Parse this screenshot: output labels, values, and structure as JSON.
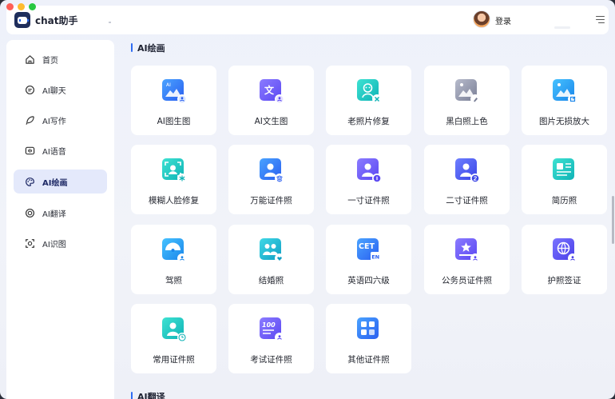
{
  "app": {
    "title": "chat助手"
  },
  "header": {
    "login_label": "登录"
  },
  "sidebar": {
    "items": [
      {
        "id": "home",
        "label": "首页",
        "icon": "home-icon",
        "active": false
      },
      {
        "id": "chat",
        "label": "AI聊天",
        "icon": "chat-bubble-icon",
        "active": false
      },
      {
        "id": "write",
        "label": "AI写作",
        "icon": "feather-icon",
        "active": false
      },
      {
        "id": "voice",
        "label": "AI语音",
        "icon": "voice-icon",
        "active": false
      },
      {
        "id": "paint",
        "label": "AI绘画",
        "icon": "palette-icon",
        "active": true
      },
      {
        "id": "translate",
        "label": "AI翻译",
        "icon": "translate-icon",
        "active": false
      },
      {
        "id": "recognize",
        "label": "AI识图",
        "icon": "scan-icon",
        "active": false
      }
    ]
  },
  "main": {
    "section_title": "AI绘画",
    "next_section_title": "AI翻译",
    "tools": [
      {
        "label": "AI图生图",
        "icon": "image-to-image-icon",
        "color": "#2f6cf2"
      },
      {
        "label": "AI文生图",
        "icon": "text-to-image-icon",
        "color": "#6a5af9"
      },
      {
        "label": "老照片修复",
        "icon": "old-photo-repair-icon",
        "color": "#14c3c0"
      },
      {
        "label": "黑白照上色",
        "icon": "colorize-photo-icon",
        "color": "#8e93a8"
      },
      {
        "label": "图片无损放大",
        "icon": "image-upscale-icon",
        "color": "#1aa6f0"
      },
      {
        "label": "模糊人脸修复",
        "icon": "face-repair-icon",
        "color": "#14c3c0"
      },
      {
        "label": "万能证件照",
        "icon": "universal-id-photo-icon",
        "color": "#2f6cf2"
      },
      {
        "label": "一寸证件照",
        "icon": "one-inch-photo-icon",
        "color": "#6a5af9"
      },
      {
        "label": "二寸证件照",
        "icon": "two-inch-photo-icon",
        "color": "#4b5cf5"
      },
      {
        "label": "简历照",
        "icon": "resume-photo-icon",
        "color": "#14c3c0"
      },
      {
        "label": "驾照",
        "icon": "driver-license-icon",
        "color": "#1aa6f0"
      },
      {
        "label": "结婚照",
        "icon": "marriage-photo-icon",
        "color": "#14b8c8"
      },
      {
        "label": "英语四六级",
        "icon": "cet-icon",
        "color": "#2f6cf2"
      },
      {
        "label": "公务员证件照",
        "icon": "civil-servant-photo-icon",
        "color": "#6a5af9"
      },
      {
        "label": "护照签证",
        "icon": "passport-visa-icon",
        "color": "#5a55f5"
      },
      {
        "label": "常用证件照",
        "icon": "common-id-photo-icon",
        "color": "#14c3c0"
      },
      {
        "label": "考试证件照",
        "icon": "exam-photo-icon",
        "color": "#6a5af9"
      },
      {
        "label": "其他证件照",
        "icon": "other-id-photo-icon",
        "color": "#2f6cf2"
      }
    ],
    "cet_text": "CET",
    "cet_sub": "EN",
    "exam_text": "100",
    "text_icon_char": "文",
    "ai_char": "AI"
  }
}
